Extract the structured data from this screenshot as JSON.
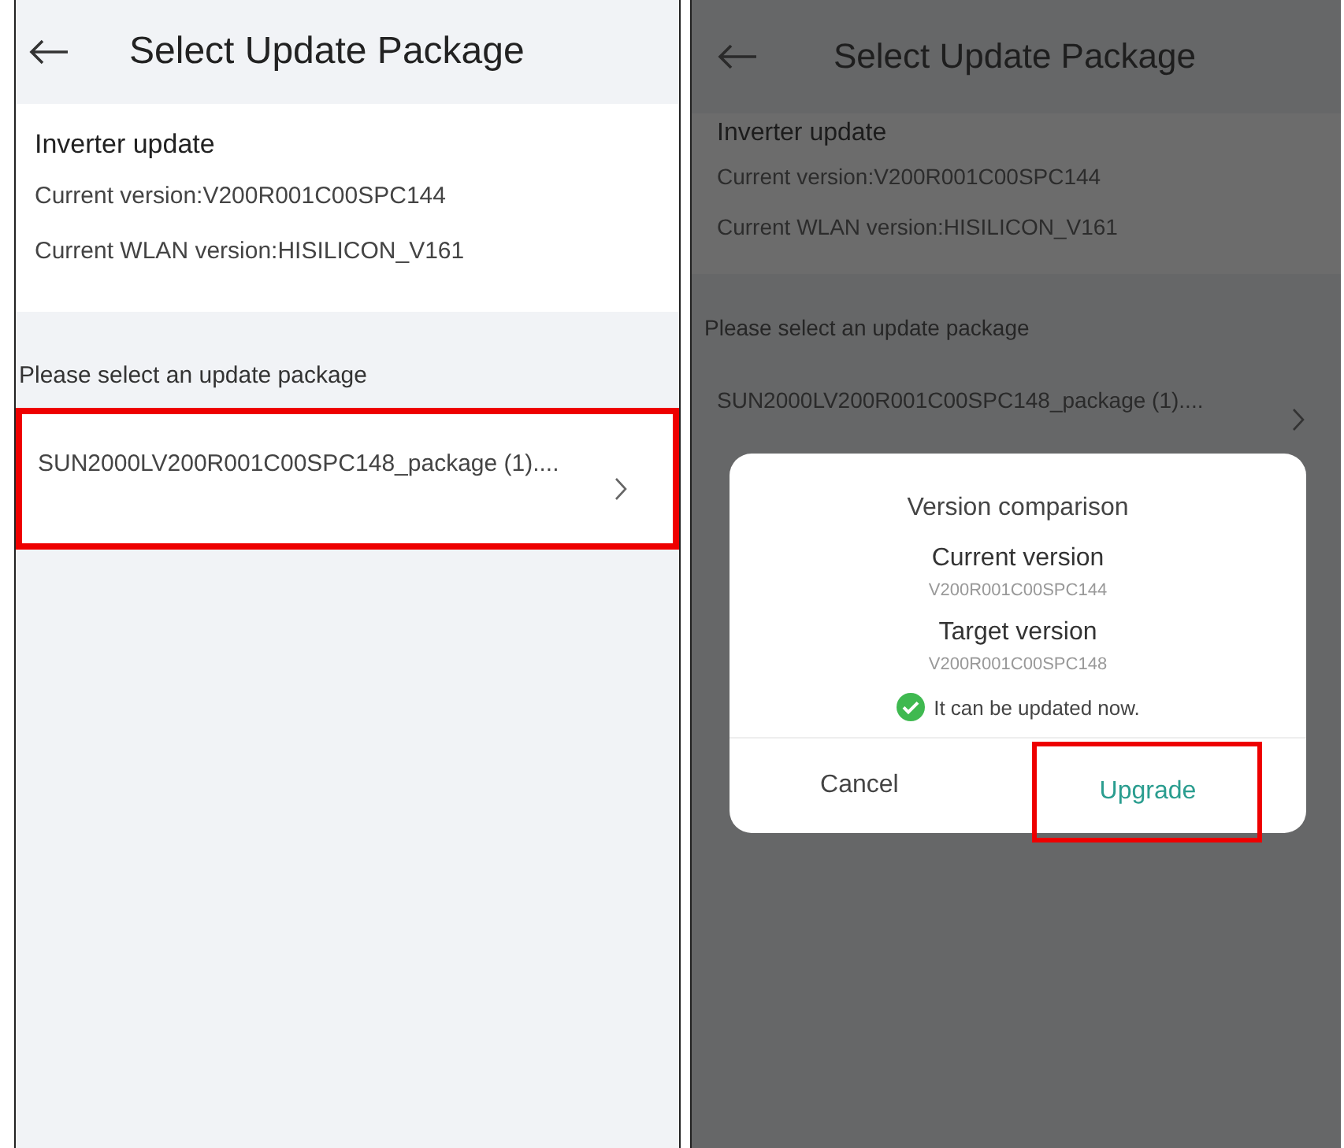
{
  "screens": [
    {
      "dimmed": false,
      "header": {
        "title": "Select Update Package"
      },
      "section": {
        "title": "Inverter update",
        "lines": [
          "Current version:V200R001C00SPC144",
          "Current WLAN version:HISILICON_V161"
        ]
      },
      "prompt": "Please select an update package",
      "packages": [
        {
          "name": "SUN2000LV200R001C00SPC148_package (1)....",
          "highlighted": true
        }
      ]
    },
    {
      "dimmed": true,
      "header": {
        "title": "Select Update Package"
      },
      "section": {
        "title": "Inverter update",
        "lines": [
          "Current version:V200R001C00SPC144",
          "Current WLAN version:HISILICON_V161"
        ]
      },
      "prompt": "Please select an update package",
      "packages": [
        {
          "name": "SUN2000LV200R001C00SPC148_package (1)....",
          "highlighted": false
        }
      ],
      "dialog": {
        "title": "Version comparison",
        "rows": [
          {
            "label": "Current version",
            "value": "V200R001C00SPC144"
          },
          {
            "label": "Target version",
            "value": "V200R001C00SPC148"
          }
        ],
        "status": {
          "text": "It can be updated now.",
          "ok": true
        },
        "buttons": [
          {
            "label": "Cancel",
            "kind": "cancel",
            "highlighted": false
          },
          {
            "label": "Upgrade",
            "kind": "confirm",
            "highlighted": true
          }
        ]
      }
    }
  ]
}
